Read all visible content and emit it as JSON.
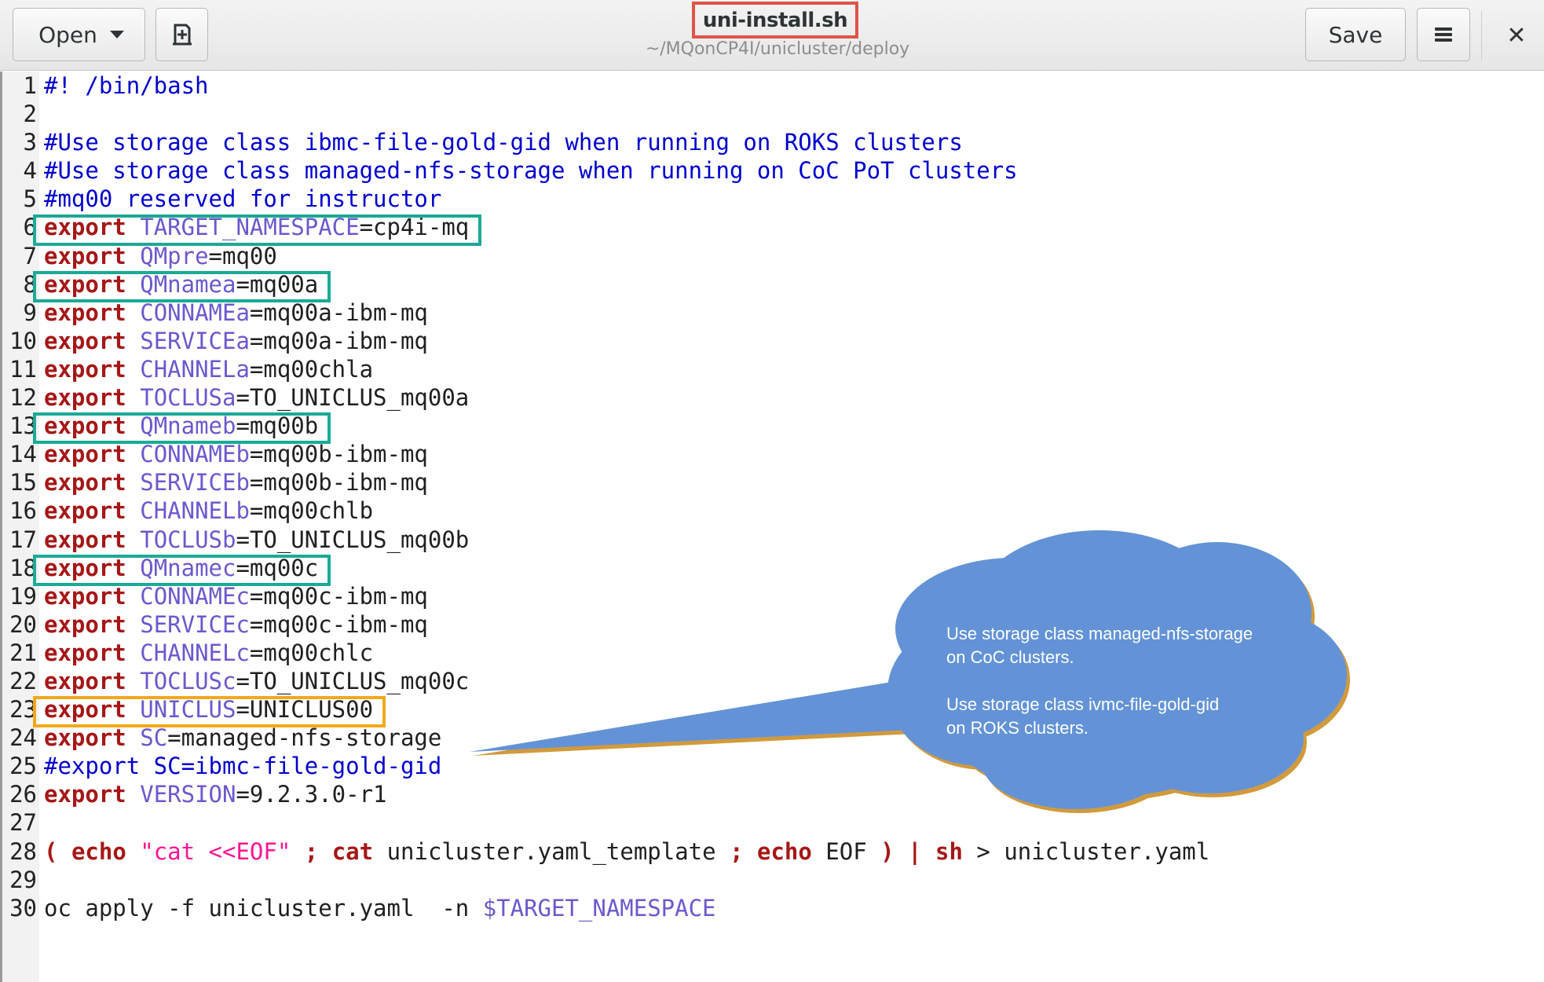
{
  "header": {
    "open_label": "Open",
    "save_label": "Save",
    "title": "uni-install.sh",
    "subtitle": "~/MQonCP4I/unicluster/deploy",
    "close_glyph": "✕"
  },
  "icons": {
    "open_menu": "chevron-down-icon",
    "new_document": "new-document-icon",
    "app_menu": "hamburger-menu-icon",
    "close": "close-icon"
  },
  "colors": {
    "keyword": "#a61717",
    "variable": "#6a5acd",
    "string": "#ff1493",
    "comment": "#0000cd",
    "plain": "#202020",
    "title_highlight": "#e0534a",
    "green_highlight": "#1aaa96",
    "orange_highlight": "#f2a91a",
    "callout_fill": "#6493d6"
  },
  "code_lines": [
    {
      "n": "1",
      "segs": [
        [
          "cmt",
          "#! /bin/bash"
        ]
      ]
    },
    {
      "n": "2",
      "segs": []
    },
    {
      "n": "3",
      "segs": [
        [
          "cmt",
          "#Use storage class ibmc-file-gold-gid when running on ROKS clusters"
        ]
      ]
    },
    {
      "n": "4",
      "segs": [
        [
          "cmt",
          "#Use storage class managed-nfs-storage when running on CoC PoT clusters"
        ]
      ]
    },
    {
      "n": "5",
      "segs": [
        [
          "cmt",
          "#mq00 reserved for instructor"
        ]
      ]
    },
    {
      "n": "6",
      "segs": [
        [
          "kw",
          "export"
        ],
        [
          "pl",
          " "
        ],
        [
          "var",
          "TARGET_NAMESPACE"
        ],
        [
          "pl",
          "=cp4i-mq"
        ]
      ],
      "hl": "green"
    },
    {
      "n": "7",
      "segs": [
        [
          "kw",
          "export"
        ],
        [
          "pl",
          " "
        ],
        [
          "var",
          "QMpre"
        ],
        [
          "pl",
          "=mq00"
        ]
      ]
    },
    {
      "n": "8",
      "segs": [
        [
          "kw",
          "export"
        ],
        [
          "pl",
          " "
        ],
        [
          "var",
          "QMnamea"
        ],
        [
          "pl",
          "=mq00a"
        ]
      ],
      "hl": "green"
    },
    {
      "n": "9",
      "segs": [
        [
          "kw",
          "export"
        ],
        [
          "pl",
          " "
        ],
        [
          "var",
          "CONNAMEa"
        ],
        [
          "pl",
          "=mq00a-ibm-mq"
        ]
      ]
    },
    {
      "n": "10",
      "segs": [
        [
          "kw",
          "export"
        ],
        [
          "pl",
          " "
        ],
        [
          "var",
          "SERVICEa"
        ],
        [
          "pl",
          "=mq00a-ibm-mq"
        ]
      ]
    },
    {
      "n": "11",
      "segs": [
        [
          "kw",
          "export"
        ],
        [
          "pl",
          " "
        ],
        [
          "var",
          "CHANNELa"
        ],
        [
          "pl",
          "=mq00chla"
        ]
      ]
    },
    {
      "n": "12",
      "segs": [
        [
          "kw",
          "export"
        ],
        [
          "pl",
          " "
        ],
        [
          "var",
          "TOCLUSa"
        ],
        [
          "pl",
          "=TO_UNICLUS_mq00a"
        ]
      ]
    },
    {
      "n": "13",
      "segs": [
        [
          "kw",
          "export"
        ],
        [
          "pl",
          " "
        ],
        [
          "var",
          "QMnameb"
        ],
        [
          "pl",
          "=mq00b"
        ]
      ],
      "hl": "green"
    },
    {
      "n": "14",
      "segs": [
        [
          "kw",
          "export"
        ],
        [
          "pl",
          " "
        ],
        [
          "var",
          "CONNAMEb"
        ],
        [
          "pl",
          "=mq00b-ibm-mq"
        ]
      ]
    },
    {
      "n": "15",
      "segs": [
        [
          "kw",
          "export"
        ],
        [
          "pl",
          " "
        ],
        [
          "var",
          "SERVICEb"
        ],
        [
          "pl",
          "=mq00b-ibm-mq"
        ]
      ]
    },
    {
      "n": "16",
      "segs": [
        [
          "kw",
          "export"
        ],
        [
          "pl",
          " "
        ],
        [
          "var",
          "CHANNELb"
        ],
        [
          "pl",
          "=mq00chlb"
        ]
      ]
    },
    {
      "n": "17",
      "segs": [
        [
          "kw",
          "export"
        ],
        [
          "pl",
          " "
        ],
        [
          "var",
          "TOCLUSb"
        ],
        [
          "pl",
          "=TO_UNICLUS_mq00b"
        ]
      ]
    },
    {
      "n": "18",
      "segs": [
        [
          "kw",
          "export"
        ],
        [
          "pl",
          " "
        ],
        [
          "var",
          "QMnamec"
        ],
        [
          "pl",
          "=mq00c"
        ]
      ],
      "hl": "green"
    },
    {
      "n": "19",
      "segs": [
        [
          "kw",
          "export"
        ],
        [
          "pl",
          " "
        ],
        [
          "var",
          "CONNAMEc"
        ],
        [
          "pl",
          "=mq00c-ibm-mq"
        ]
      ]
    },
    {
      "n": "20",
      "segs": [
        [
          "kw",
          "export"
        ],
        [
          "pl",
          " "
        ],
        [
          "var",
          "SERVICEc"
        ],
        [
          "pl",
          "=mq00c-ibm-mq"
        ]
      ]
    },
    {
      "n": "21",
      "segs": [
        [
          "kw",
          "export"
        ],
        [
          "pl",
          " "
        ],
        [
          "var",
          "CHANNELc"
        ],
        [
          "pl",
          "=mq00chlc"
        ]
      ]
    },
    {
      "n": "22",
      "segs": [
        [
          "kw",
          "export"
        ],
        [
          "pl",
          " "
        ],
        [
          "var",
          "TOCLUSc"
        ],
        [
          "pl",
          "=TO_UNICLUS_mq00c"
        ]
      ]
    },
    {
      "n": "23",
      "segs": [
        [
          "kw",
          "export"
        ],
        [
          "pl",
          " "
        ],
        [
          "var",
          "UNICLUS"
        ],
        [
          "pl",
          "=UNICLUS00"
        ]
      ],
      "hl": "orange"
    },
    {
      "n": "24",
      "segs": [
        [
          "kw",
          "export"
        ],
        [
          "pl",
          " "
        ],
        [
          "var",
          "SC"
        ],
        [
          "pl",
          "=managed-nfs-storage"
        ]
      ]
    },
    {
      "n": "25",
      "segs": [
        [
          "cmt",
          "#export SC=ibmc-file-gold-gid"
        ]
      ]
    },
    {
      "n": "26",
      "segs": [
        [
          "kw",
          "export"
        ],
        [
          "pl",
          " "
        ],
        [
          "var",
          "VERSION"
        ],
        [
          "pl",
          "=9.2.3.0-r1"
        ]
      ]
    },
    {
      "n": "27",
      "segs": []
    },
    {
      "n": "28",
      "segs": [
        [
          "kw",
          "("
        ],
        [
          "pl",
          " "
        ],
        [
          "kw",
          "echo"
        ],
        [
          "pl",
          " "
        ],
        [
          "str",
          "\"cat <<EOF\""
        ],
        [
          "pl",
          " "
        ],
        [
          "kw",
          ";"
        ],
        [
          "pl",
          " "
        ],
        [
          "kw",
          "cat"
        ],
        [
          "pl",
          " unicluster.yaml_template "
        ],
        [
          "kw",
          ";"
        ],
        [
          "pl",
          " "
        ],
        [
          "kw",
          "echo"
        ],
        [
          "pl",
          " EOF "
        ],
        [
          "kw",
          ")"
        ],
        [
          "pl",
          " "
        ],
        [
          "kw",
          "|"
        ],
        [
          "pl",
          " "
        ],
        [
          "kw",
          "sh"
        ],
        [
          "pl",
          " > unicluster.yaml"
        ]
      ]
    },
    {
      "n": "29",
      "segs": []
    },
    {
      "n": "30",
      "segs": [
        [
          "pl",
          "oc apply -f unicluster.yaml  -n "
        ],
        [
          "var",
          "$TARGET_NAMESPACE"
        ]
      ]
    }
  ],
  "callout": {
    "line1": "Use storage class managed-nfs-storage",
    "line2": "on CoC clusters.",
    "line3": "Use storage class ivmc-file-gold-gid",
    "line4": "on ROKS clusters."
  }
}
